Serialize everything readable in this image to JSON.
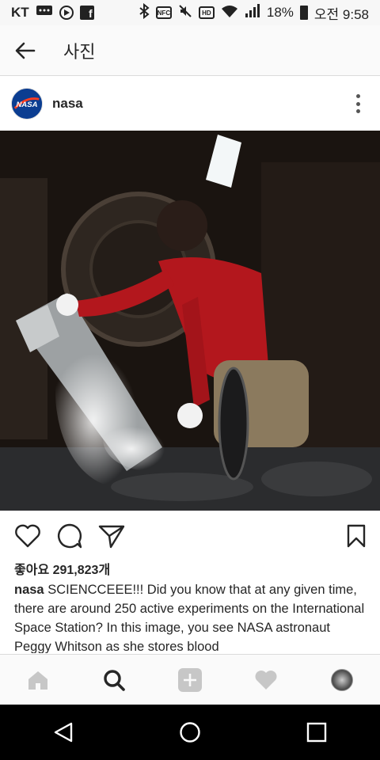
{
  "status_bar": {
    "carrier": "KT",
    "battery": "18%",
    "time": "오전 9:58",
    "icons": [
      "message-icon",
      "play-icon",
      "facebook-icon",
      "bluetooth-icon",
      "nfc-icon",
      "mute-icon",
      "hd-icon",
      "wifi-icon",
      "signal-icon",
      "battery-icon"
    ],
    "nfc_label": "NFC",
    "hd_label": "HD"
  },
  "app_bar": {
    "title": "사진"
  },
  "post": {
    "username": "nasa",
    "avatar_label": "NASA",
    "likes": "좋아요 291,823개",
    "caption_user": "nasa",
    "caption_text": " SCIENCCEEE!!! Did you know that at any given time, there are around 250 active experiments on the International Space Station? In this image, you see NASA astronaut Peggy Whitson as she stores blood"
  },
  "actions": [
    "heart-icon",
    "comment-icon",
    "share-icon",
    "bookmark-icon"
  ],
  "tab_bar": [
    "home-icon",
    "search-icon",
    "add-icon",
    "activity-icon",
    "profile-avatar"
  ],
  "nav_bar": [
    "back-triangle-icon",
    "home-circle-icon",
    "recents-square-icon"
  ],
  "colors": {
    "text": "#262626",
    "bar_bg": "#fafafa",
    "divider": "#dbdbdb",
    "inactive_icon": "#c7c7c7",
    "sweater": "#b3171d"
  }
}
